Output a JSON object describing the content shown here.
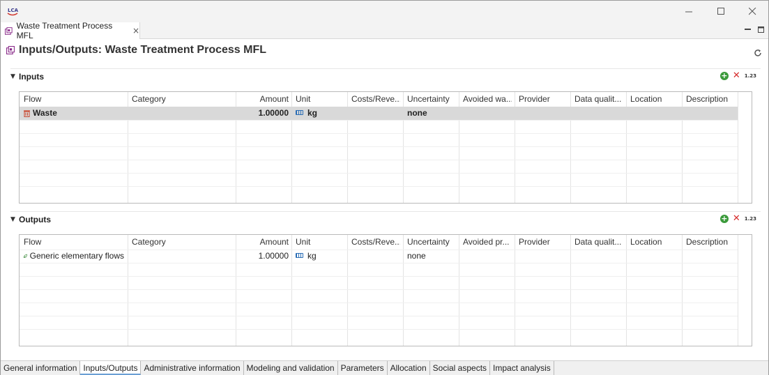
{
  "window": {
    "logo_text": "LCA",
    "controls": [
      "minimize",
      "maximize",
      "close"
    ]
  },
  "editor_tab": {
    "label": "Waste Treatment Process MFL",
    "close": "×"
  },
  "form": {
    "title": "Inputs/Outputs: Waste Treatment Process MFL"
  },
  "columns": {
    "inputs": [
      "Flow",
      "Category",
      "Amount",
      "Unit",
      "Costs/Reve...",
      "Uncertainty",
      "Avoided wa...",
      "Provider",
      "Data qualit...",
      "Location",
      "Description"
    ],
    "outputs": [
      "Flow",
      "Category",
      "Amount",
      "Unit",
      "Costs/Reve...",
      "Uncertainty",
      "Avoided pr...",
      "Provider",
      "Data qualit...",
      "Location",
      "Description"
    ]
  },
  "inputs": {
    "title": "Inputs",
    "tools": {
      "add": "+",
      "remove": "✕",
      "format": "1.23"
    },
    "rows": [
      {
        "flow": "Waste",
        "category": "",
        "amount": "1.00000",
        "unit": "kg",
        "costs": "",
        "uncertainty": "none",
        "avoided": "",
        "provider": "",
        "data_quality": "",
        "location": "",
        "description": "",
        "icon": "waste-icon",
        "selected": true,
        "bold": true
      }
    ]
  },
  "outputs": {
    "title": "Outputs",
    "tools": {
      "add": "+",
      "remove": "✕",
      "format": "1.23"
    },
    "rows": [
      {
        "flow": "Generic elementary flows",
        "category": "",
        "amount": "1.00000",
        "unit": "kg",
        "costs": "",
        "uncertainty": "none",
        "avoided": "",
        "provider": "",
        "data_quality": "",
        "location": "",
        "description": "",
        "icon": "leaf-icon",
        "selected": false,
        "bold": false
      }
    ]
  },
  "page_tabs": [
    {
      "label": "General information",
      "active": false
    },
    {
      "label": "Inputs/Outputs",
      "active": true
    },
    {
      "label": "Administrative information",
      "active": false
    },
    {
      "label": "Modeling and validation",
      "active": false
    },
    {
      "label": "Parameters",
      "active": false
    },
    {
      "label": "Allocation",
      "active": false
    },
    {
      "label": "Social aspects",
      "active": false
    },
    {
      "label": "Impact analysis",
      "active": false
    }
  ],
  "colors": {
    "selection": "#d9d9d9",
    "accent": "#6b9fd4",
    "add_green": "#3b9a3b",
    "remove_red": "#d62b2b",
    "unit_blue": "#2a6db5"
  }
}
